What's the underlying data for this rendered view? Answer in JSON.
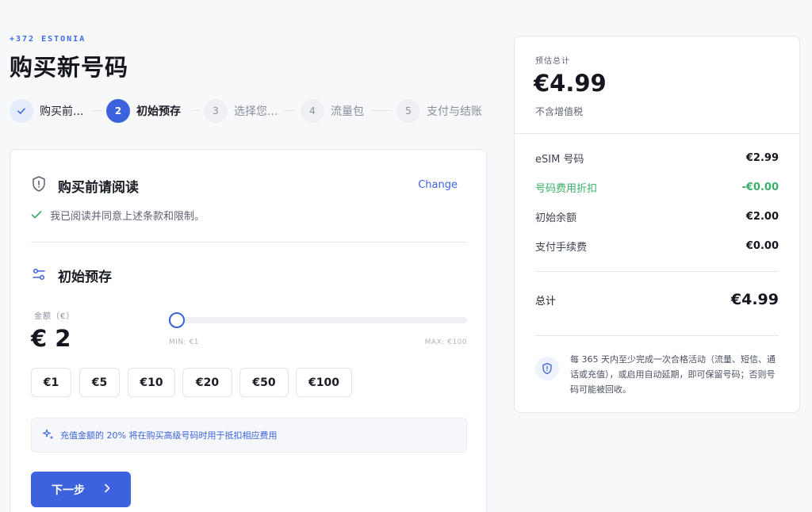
{
  "header": {
    "eyebrow": "+372 ESTONIA",
    "title": "购买新号码"
  },
  "stepper": {
    "steps": [
      {
        "number": "1",
        "label": "购买前...",
        "state": "done"
      },
      {
        "number": "2",
        "label": "初始预存",
        "state": "active"
      },
      {
        "number": "3",
        "label": "选择您...",
        "state": "pending"
      },
      {
        "number": "4",
        "label": "流量包",
        "state": "pending"
      },
      {
        "number": "5",
        "label": "支付与结账",
        "state": "pending"
      }
    ]
  },
  "read_section": {
    "title": "购买前请阅读",
    "change_label": "Change",
    "agree_text": "我已阅读并同意上述条款和限制。",
    "icon": "shield-icon"
  },
  "topup_section": {
    "title": "初始预存",
    "icon": "sliders-icon",
    "amount_label": "金额（€）",
    "amount_value": "€ 2",
    "slider": {
      "min_label": "MIN: €1",
      "max_label": "MAX: €100",
      "min": 1,
      "max": 100,
      "value": 2
    },
    "presets": [
      "€1",
      "€5",
      "€10",
      "€20",
      "€50",
      "€100"
    ],
    "note": "充值金额的 20% 将在购买高级号码时用于抵扣相应费用",
    "next_label": "下一步"
  },
  "summary": {
    "label": "预估总计",
    "total": "€4.99",
    "vat_note": "不含增值税",
    "rows": [
      {
        "key": "eSIM 号码",
        "value": "€2.99"
      },
      {
        "key": "号码费用折扣",
        "value": "-€0.00"
      },
      {
        "key": "初始余额",
        "value": "€2.00"
      },
      {
        "key": "支付手续费",
        "value": "€0.00"
      }
    ],
    "total_row": {
      "key": "总计",
      "value": "€4.99"
    },
    "policy": "每 365 天内至少完成一次合格活动（流量、短信、通话或充值），或启用自动延期，即可保留号码；否则号码可能被回收。"
  },
  "colors": {
    "accent": "#3c63dd",
    "discount": "#3aae6a",
    "check": "#3aae6a"
  }
}
